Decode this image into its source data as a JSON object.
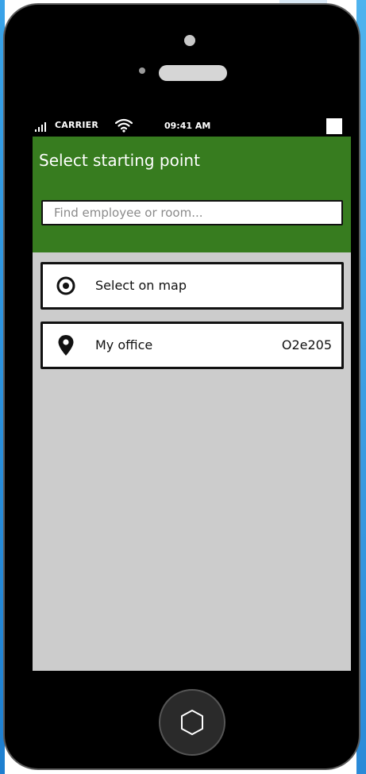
{
  "status_bar": {
    "carrier": "CARRIER",
    "time": "09:41 AM"
  },
  "header": {
    "title": "Select starting point",
    "search_placeholder": "Find employee or room..."
  },
  "items": [
    {
      "icon": "target-icon",
      "label": "Select on map",
      "value": ""
    },
    {
      "icon": "map-pin-icon",
      "label": "My office",
      "value": "O2e205"
    }
  ],
  "colors": {
    "header_bg": "#377c1f",
    "screen_bg": "#cccccc",
    "phone_body": "#000000"
  }
}
